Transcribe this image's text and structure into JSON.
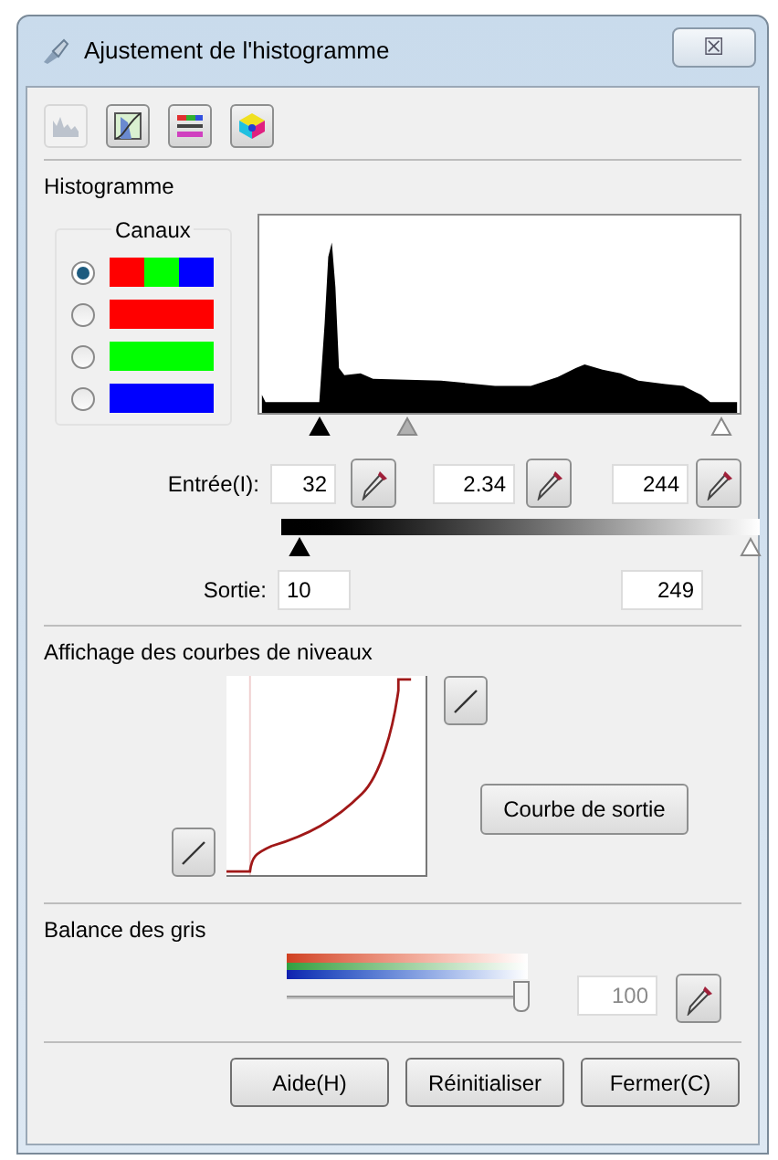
{
  "window": {
    "title": "Ajustement de l'histogramme",
    "close": "☒"
  },
  "toolbar": [
    {
      "kind": "histogram",
      "disabled": true
    },
    {
      "kind": "curve",
      "disabled": false
    },
    {
      "kind": "balance",
      "disabled": false
    },
    {
      "kind": "color",
      "disabled": false
    }
  ],
  "histogram": {
    "title": "Histogramme",
    "channels_title": "Canaux",
    "channels": [
      {
        "selected": true,
        "colors": [
          {
            "color": "#ff0000"
          },
          {
            "color": "#00ff00"
          },
          {
            "color": "#0000ff"
          }
        ]
      },
      {
        "selected": false,
        "colors": [
          {
            "color": "#ff0000"
          }
        ]
      },
      {
        "selected": false,
        "colors": [
          {
            "color": "#00ff00"
          }
        ]
      },
      {
        "selected": false,
        "colors": [
          {
            "color": "#0000ff"
          }
        ]
      }
    ],
    "input_markers": [
      {
        "kind": "black"
      },
      {
        "kind": "gray"
      },
      {
        "kind": "white"
      }
    ],
    "input_label": "Entrée(I):",
    "inputs": [
      "32",
      "2.34",
      "244"
    ],
    "output_markers": [
      {
        "kind": "black"
      },
      {
        "kind": "white"
      }
    ],
    "output_label": "Sortie:",
    "outputs": [
      "10",
      "249"
    ]
  },
  "curves": {
    "title": "Affichage des courbes de niveaux",
    "output_button": "Courbe de sortie"
  },
  "gray_balance": {
    "title": "Balance des gris",
    "level": 0.98,
    "value": "100"
  },
  "buttons": [
    "Aide(H)",
    "Réinitialiser",
    "Fermer(C)"
  ]
}
